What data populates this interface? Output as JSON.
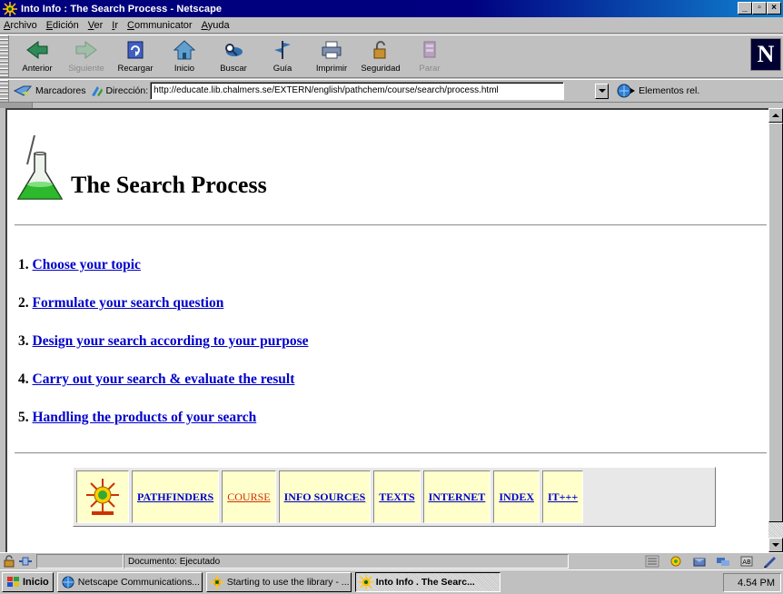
{
  "window": {
    "title": "Into Info : The Search Process - Netscape"
  },
  "menu": [
    "Archivo",
    "Edición",
    "Ver",
    "Ir",
    "Communicator",
    "Ayuda"
  ],
  "toolbar": [
    {
      "label": "Anterior",
      "icon": "back-arrow-icon",
      "enabled": true
    },
    {
      "label": "Siguiente",
      "icon": "forward-arrow-icon",
      "enabled": false
    },
    {
      "label": "Recargar",
      "icon": "reload-icon",
      "enabled": true
    },
    {
      "label": "Inicio",
      "icon": "home-icon",
      "enabled": true
    },
    {
      "label": "Buscar",
      "icon": "search-icon",
      "enabled": true
    },
    {
      "label": "Guía",
      "icon": "guide-icon",
      "enabled": true
    },
    {
      "label": "Imprimir",
      "icon": "print-icon",
      "enabled": true
    },
    {
      "label": "Seguridad",
      "icon": "security-lock-icon",
      "enabled": true
    },
    {
      "label": "Parar",
      "icon": "stop-icon",
      "enabled": false
    }
  ],
  "location": {
    "bookmarks_label": "Marcadores",
    "address_label": "Dirección:",
    "url": "http://educate.lib.chalmers.se/EXTERN/english/pathchem/course/search/process.html",
    "related_label": "Elementos rel."
  },
  "page": {
    "title": "The Search Process",
    "steps": [
      {
        "num": "1.",
        "text": "Choose your topic"
      },
      {
        "num": "2.",
        "text": "Formulate your search question"
      },
      {
        "num": "3.",
        "text": "Design your search according to your purpose"
      },
      {
        "num": "4.",
        "text": "Carry out your search & evaluate the result"
      },
      {
        "num": "5.",
        "text": "Handling the products of your search"
      }
    ],
    "nav": [
      {
        "label": "PATHFINDERS",
        "current": false
      },
      {
        "label": "COURSE",
        "current": true
      },
      {
        "label": "INFO SOURCES",
        "current": false
      },
      {
        "label": "TEXTS",
        "current": false
      },
      {
        "label": "INTERNET",
        "current": false
      },
      {
        "label": "INDEX",
        "current": false
      },
      {
        "label": "IT+++",
        "current": false
      }
    ]
  },
  "status": {
    "text": "Documento: Ejecutado"
  },
  "taskbar": {
    "start_label": "Inicio",
    "tasks": [
      {
        "label": "Netscape Communications...",
        "active": false
      },
      {
        "label": "Starting to use the library - ...",
        "active": false
      },
      {
        "label": "Into Info . The Searc...",
        "active": true
      }
    ],
    "clock": "4.54 PM"
  },
  "colors": {
    "link": "#0000cc",
    "current_link": "#cc3300",
    "nav_cell_bg": "#ffffcc",
    "title_bar": "#000080"
  }
}
